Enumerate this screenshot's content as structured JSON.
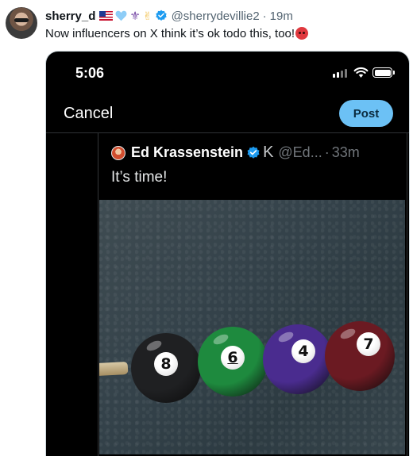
{
  "tweet": {
    "display_name": "sherry_d",
    "handle": "@sherrydevillie2",
    "separator": "·",
    "time": "19m",
    "text": "Now influencers on X think it’s ok todo this, too!",
    "name_emojis": [
      "us-flag-icon",
      "light-blue-heart-icon",
      "fleur-de-lis-icon",
      "victory-hand-icon"
    ],
    "trailing_emoji": "angry-face-icon",
    "colors": {
      "verified": "#1d9bf0",
      "muted": "#536471"
    }
  },
  "screenshot": {
    "status_time": "5:06",
    "compose": {
      "cancel_label": "Cancel",
      "post_label": "Post",
      "post_color": "#6cc1f5"
    },
    "quote": {
      "display_name": "Ed Krassenstein",
      "handle": "@Ed...",
      "separator": "·",
      "time": "33m",
      "text": "It’s time!",
      "affiliate_badge": "K"
    },
    "photo": {
      "balls": [
        {
          "number": "8",
          "color": "#1f2022"
        },
        {
          "number": "6",
          "color": "#1e8a3e"
        },
        {
          "number": "4",
          "color": "#4a2c8f"
        },
        {
          "number": "7",
          "color": "#6b1a22"
        }
      ]
    }
  }
}
